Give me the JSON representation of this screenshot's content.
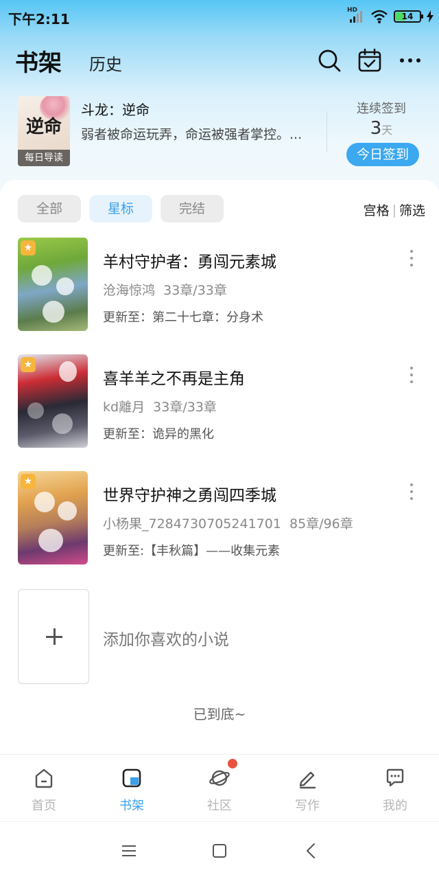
{
  "status_bar": {
    "time": "下午2:11",
    "network": "HD",
    "battery": "14",
    "colors": {
      "battery_fill": "#4cd964"
    }
  },
  "header": {
    "tabs": [
      {
        "label": "书架",
        "active": true
      },
      {
        "label": "历史",
        "active": false
      }
    ],
    "icons": [
      "search-icon",
      "calendar-check-icon",
      "more-horizontal-icon"
    ]
  },
  "featured": {
    "cover_title": "逆命",
    "cover_label": "每日导读",
    "title": "斗龙：逆命",
    "description": "弱者被命运玩弄，命运被强者掌控。...",
    "checkin": {
      "label": "连续签到",
      "count": "3",
      "unit": "天",
      "button": "今日签到"
    }
  },
  "filters": {
    "chips": [
      {
        "label": "全部",
        "active": false
      },
      {
        "label": "星标",
        "active": true
      },
      {
        "label": "完结",
        "active": false
      }
    ],
    "view_grid": "宫格",
    "view_filter": "筛选"
  },
  "books": [
    {
      "title": "羊村守护者：勇闯元素城",
      "author": "沧海惊鸿",
      "chapters": "33章/33章",
      "update": "更新至：第二十七章：分身术",
      "starred": true
    },
    {
      "title": "喜羊羊之不再是主角",
      "author": "kd離月",
      "chapters": "33章/33章",
      "update": "更新至：诡异的黑化",
      "starred": true
    },
    {
      "title": "世界守护神之勇闯四季城",
      "author": "小杨果_7284730705241701",
      "chapters": "85章/96章",
      "update": "更新至:【丰秋篇】——收集元素",
      "starred": true
    }
  ],
  "add_novel": "添加你喜欢的小说",
  "end_text": "已到底~",
  "bottom_nav": [
    {
      "label": "首页",
      "icon": "home-icon",
      "active": false
    },
    {
      "label": "书架",
      "icon": "bookshelf-icon",
      "active": true
    },
    {
      "label": "社区",
      "icon": "planet-icon",
      "active": false,
      "badge": true
    },
    {
      "label": "写作",
      "icon": "pen-icon",
      "active": false
    },
    {
      "label": "我的",
      "icon": "chat-bubble-icon",
      "active": false
    }
  ],
  "colors": {
    "accent": "#3aa0ea",
    "badge": "#e8533e",
    "star": "#f6b53c"
  }
}
